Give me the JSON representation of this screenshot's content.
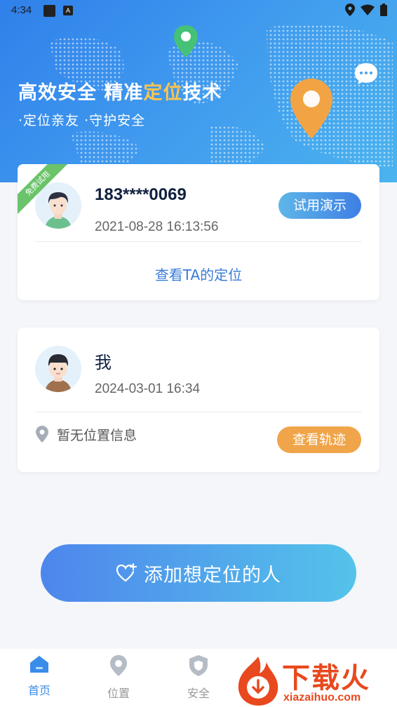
{
  "status_bar": {
    "time": "4:34",
    "app_badge": "A"
  },
  "banner": {
    "title_part1": "高效安全 精准",
    "title_highlight": "定位",
    "title_part2": "技术",
    "subtitle": "·定位亲友  ·守护安全"
  },
  "contact_card": {
    "ribbon": "免费试用",
    "name": "183****0069",
    "time": "2021-08-28 16:13:56",
    "demo_button": "试用演示",
    "view_location": "查看TA的定位"
  },
  "me_card": {
    "name": "我",
    "time": "2024-03-01 16:34",
    "no_location": "暂无位置信息",
    "track_button": "查看轨迹"
  },
  "add_button": {
    "label": "添加想定位的人"
  },
  "bottom_nav": {
    "items": [
      {
        "label": "首页",
        "icon": "home-icon",
        "active": true
      },
      {
        "label": "位置",
        "icon": "location-icon",
        "active": false
      },
      {
        "label": "安全",
        "icon": "shield-icon",
        "active": false
      }
    ]
  },
  "watermark": {
    "text": "下载火",
    "url": "xiazaihuo.com"
  },
  "colors": {
    "accent_blue": "#3a8ce9",
    "accent_orange": "#f0a54b",
    "ribbon_green": "#6bc36a"
  }
}
